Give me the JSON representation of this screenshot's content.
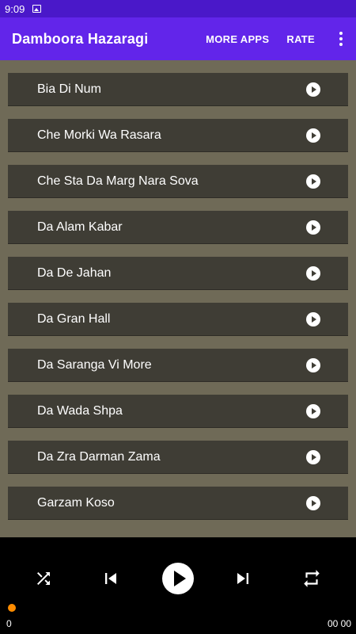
{
  "status_bar": {
    "time": "9:09"
  },
  "app_bar": {
    "title": "Damboora Hazaragi",
    "more_apps_label": "MORE APPS",
    "rate_label": "RATE"
  },
  "songs": [
    {
      "title": "Bia Di Num"
    },
    {
      "title": "Che Morki Wa Rasara"
    },
    {
      "title": "Che Sta Da Marg Nara Sova"
    },
    {
      "title": "Da Alam Kabar"
    },
    {
      "title": "Da De Jahan"
    },
    {
      "title": "Da Gran Hall"
    },
    {
      "title": "Da Saranga Vi More"
    },
    {
      "title": "Da Wada Shpa"
    },
    {
      "title": "Da Zra Darman Zama"
    },
    {
      "title": "Garzam Koso"
    }
  ],
  "player": {
    "position": "0",
    "duration": "00 00",
    "progress": 0
  },
  "colors": {
    "status_bar": "#4a18c9",
    "app_bar": "#6225ea",
    "list_background": "#6f6a57",
    "list_item": "#3f3d35",
    "progress_thumb": "#ff8c00"
  }
}
